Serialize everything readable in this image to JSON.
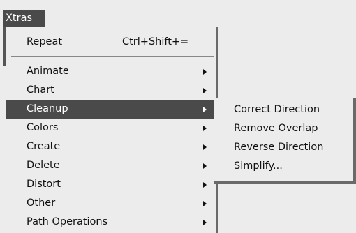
{
  "menubar": {
    "title": "Xtras"
  },
  "menu": {
    "repeat": {
      "label": "Repeat",
      "shortcut": "Ctrl+Shift+="
    },
    "items": [
      {
        "label": "Animate"
      },
      {
        "label": "Chart"
      },
      {
        "label": "Cleanup"
      },
      {
        "label": "Colors"
      },
      {
        "label": "Create"
      },
      {
        "label": "Delete"
      },
      {
        "label": "Distort"
      },
      {
        "label": "Other"
      },
      {
        "label": "Path Operations"
      }
    ],
    "highlighted_item": "Cleanup"
  },
  "submenu": {
    "items": [
      {
        "label": "Correct Direction"
      },
      {
        "label": "Remove Overlap"
      },
      {
        "label": "Reverse Direction"
      },
      {
        "label": "Simplify..."
      }
    ]
  },
  "colors": {
    "highlight_bg": "#4a4a4a",
    "highlight_text": "#ffffff",
    "menu_bg": "#ececec"
  },
  "icons": {
    "submenu_arrow": "triangle-right-icon"
  }
}
